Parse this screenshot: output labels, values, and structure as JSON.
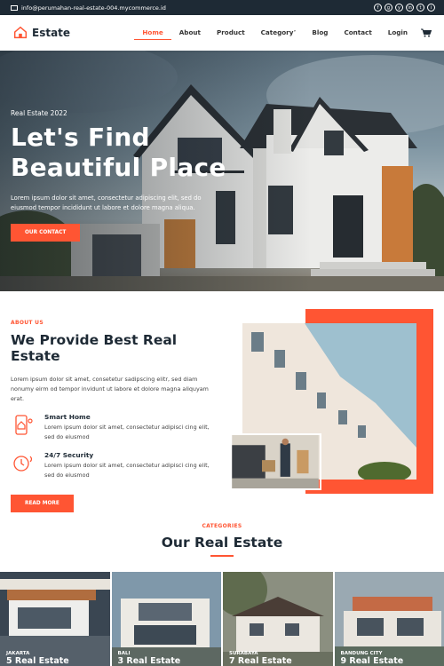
{
  "topbar": {
    "email": "info@perumahan-real-estate-004.mycommerce.id",
    "socials": [
      "f",
      "g",
      "y",
      "in",
      "t",
      "i"
    ]
  },
  "nav": {
    "brand": "Estate",
    "items": [
      "Home",
      "About",
      "Product",
      "Category",
      "Blog",
      "Contact",
      "Login"
    ],
    "active": "Home",
    "icons": {
      "cart": "cart-icon",
      "dropdown": "chevron-down-icon"
    }
  },
  "hero": {
    "eyebrow": "Real Estate 2022",
    "title_line1": "Let's Find",
    "title_line2": "Beautiful Place",
    "text": "Lorem ipsum dolor sit amet, consectetur adipiscing elit, sed do eiusmod tempor incididunt ut labore et dolore magna aliqua.",
    "button": "OUR CONTACT"
  },
  "about": {
    "eyebrow": "ABOUT US",
    "title": "We Provide Best Real Estate",
    "text": "Lorem ipsum dolor sit amet, consetetur sadipscing elitr, sed diam nonumy eirm od tempor invidunt ut labore et dolore magna aliquyam erat.",
    "features": [
      {
        "title": "Smart Home",
        "text": "Lorem ipsum dolor sit amet, consectetur adipisci cing elit, sed do eiusmod",
        "icon": "smart-home-icon"
      },
      {
        "title": "24/7 Security",
        "text": "Lorem ipsum dolor sit amet, consectetur adipisci cing elit, sed do eiusmod",
        "icon": "security-icon"
      }
    ],
    "button": "READ MORE"
  },
  "categories": {
    "eyebrow": "CATEGORIES",
    "title": "Our Real Estate",
    "cards": [
      {
        "city": "JAKARTA",
        "count": "5 Real Estate"
      },
      {
        "city": "BALI",
        "count": "3 Real Estate"
      },
      {
        "city": "SURABAYA",
        "count": "7 Real Estate"
      },
      {
        "city": "BANDUNG CITY",
        "count": "9 Real Estate"
      }
    ]
  },
  "colors": {
    "accent": "#ff5533",
    "dark": "#1e2a35"
  }
}
